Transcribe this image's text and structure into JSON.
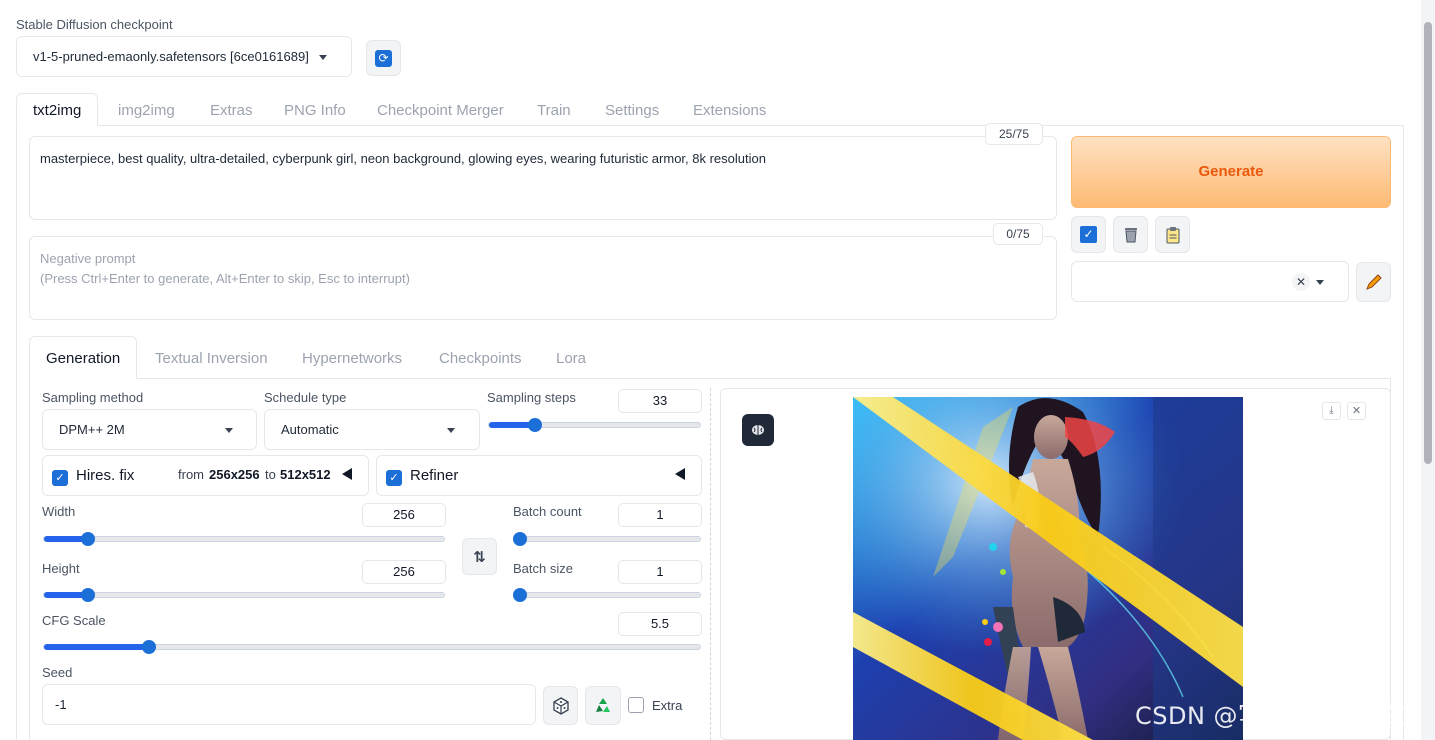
{
  "checkpoint": {
    "label": "Stable Diffusion checkpoint",
    "value": "v1-5-pruned-emaonly.safetensors [6ce0161689]",
    "refresh_icon": "refresh-icon"
  },
  "main_tabs": [
    "txt2img",
    "img2img",
    "Extras",
    "PNG Info",
    "Checkpoint Merger",
    "Train",
    "Settings",
    "Extensions"
  ],
  "prompt": {
    "value": "masterpiece, best quality, ultra-detailed, cyberpunk girl, neon background, glowing eyes, wearing futuristic armor, 8k resolution",
    "counter": "25/75"
  },
  "negative_prompt": {
    "placeholder_line1": "Negative prompt",
    "placeholder_line2": "(Press Ctrl+Enter to generate, Alt+Enter to skip, Esc to interrupt)",
    "counter": "0/75"
  },
  "generate_label": "Generate",
  "tool_icons": [
    "checkbox-icon",
    "trash-icon",
    "clipboard-icon",
    "pencil-icon"
  ],
  "sub_tabs": [
    "Generation",
    "Textual Inversion",
    "Hypernetworks",
    "Checkpoints",
    "Lora"
  ],
  "sampling_method": {
    "label": "Sampling method",
    "value": "DPM++ 2M"
  },
  "schedule_type": {
    "label": "Schedule type",
    "value": "Automatic"
  },
  "sampling_steps": {
    "label": "Sampling steps",
    "value": "33",
    "fraction": 0.22
  },
  "hires": {
    "label": "Hires. fix",
    "from_text": "from",
    "from_value": "256x256",
    "to_text": "to",
    "to_value": "512x512"
  },
  "refiner": {
    "label": "Refiner"
  },
  "width": {
    "label": "Width",
    "value": "256",
    "fraction": 0.11
  },
  "height": {
    "label": "Height",
    "value": "256",
    "fraction": 0.11
  },
  "batch_count": {
    "label": "Batch count",
    "value": "1",
    "fraction": 0.0
  },
  "batch_size": {
    "label": "Batch size",
    "value": "1",
    "fraction": 0.0
  },
  "cfg_scale": {
    "label": "CFG Scale",
    "value": "5.5",
    "fraction": 0.16
  },
  "seed": {
    "label": "Seed",
    "value": "-1",
    "extra_label": "Extra"
  },
  "watermark": "CSDN @写点自己想写的"
}
